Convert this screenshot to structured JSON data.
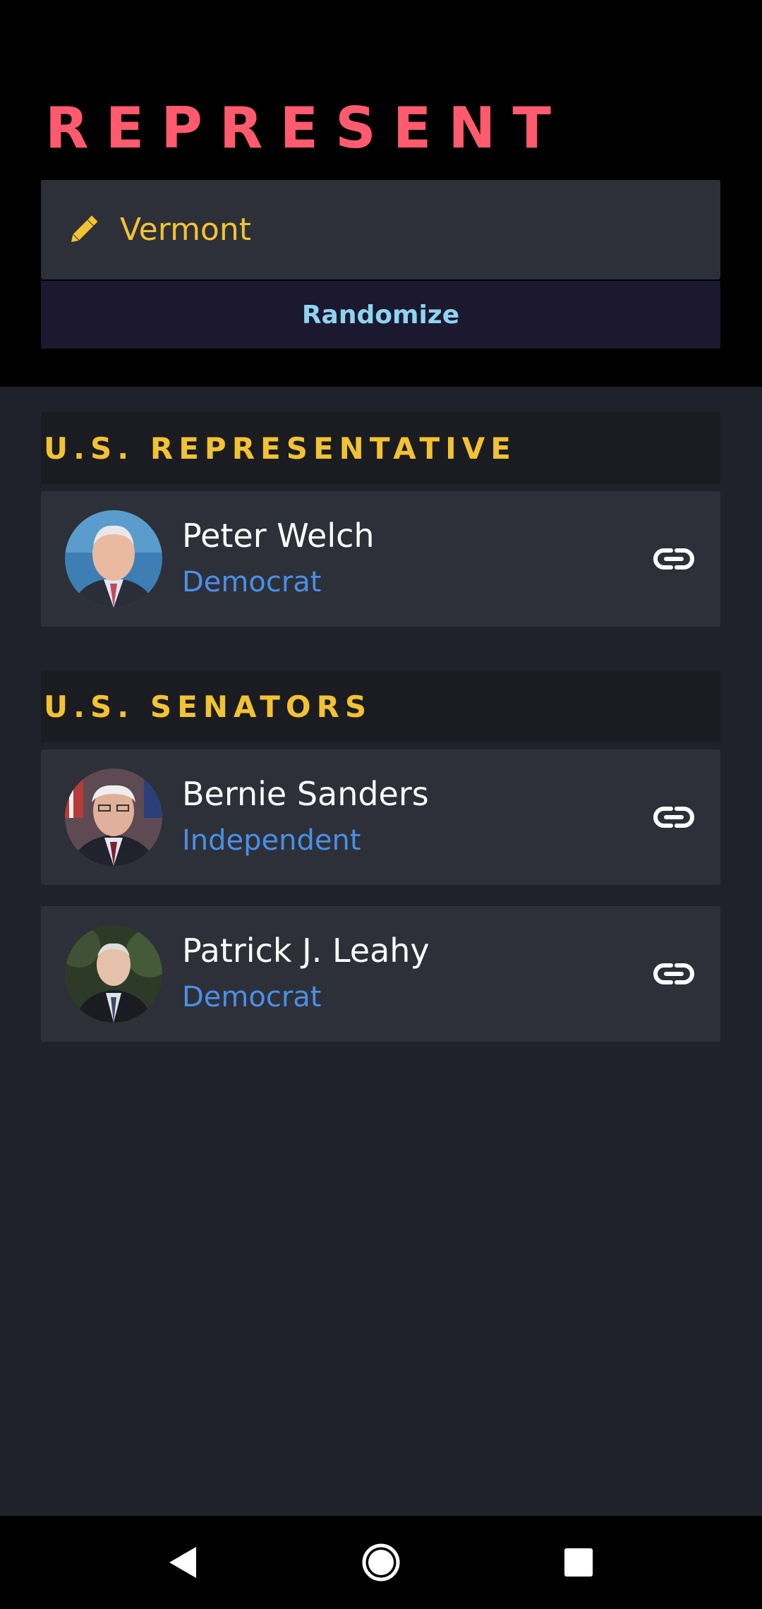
{
  "app": {
    "title": "REPRESENT"
  },
  "search": {
    "state_value": "Vermont",
    "icon": "pencil-icon"
  },
  "randomize": {
    "label": "Randomize"
  },
  "sections": [
    {
      "title": "U.S. REPRESENTATIVE",
      "members": [
        {
          "name": "Peter Welch",
          "party": "Democrat",
          "link_icon": "link-icon"
        }
      ]
    },
    {
      "title": "U.S. SENATORS",
      "members": [
        {
          "name": "Bernie Sanders",
          "party": "Independent",
          "link_icon": "link-icon"
        },
        {
          "name": "Patrick J. Leahy",
          "party": "Democrat",
          "link_icon": "link-icon"
        }
      ]
    }
  ],
  "nav": {
    "back_icon": "back-triangle-icon",
    "home_icon": "home-circle-icon",
    "recents_icon": "recents-square-icon"
  },
  "colors": {
    "accent_title": "#ff5a6e",
    "section_yellow": "#f2c233",
    "party_blue": "#4a8fe8",
    "randomize_text": "#8fd3ef",
    "card_bg": "#2d3038",
    "content_bg": "#20222b"
  }
}
